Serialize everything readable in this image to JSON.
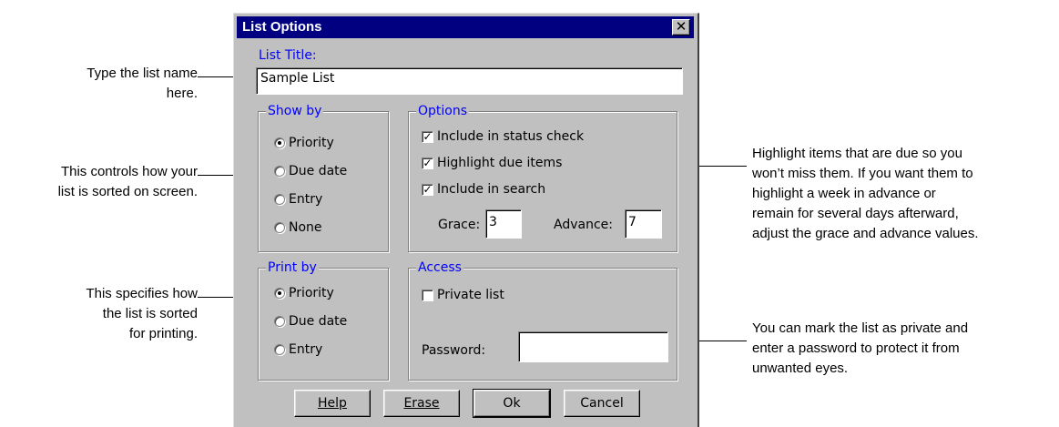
{
  "dialog": {
    "title": "List Options",
    "close_glyph": "✕"
  },
  "list_title": {
    "label": "List Title:",
    "value": "Sample List"
  },
  "show_by": {
    "label": "Show by",
    "options": [
      "Priority",
      "Due date",
      "Entry",
      "None"
    ],
    "selected": "Priority"
  },
  "options": {
    "label": "Options",
    "checks": [
      {
        "label": "Include in status check",
        "checked": true
      },
      {
        "label": "Highlight due items",
        "checked": true
      },
      {
        "label": "Include in search",
        "checked": true
      }
    ],
    "grace_label": "Grace:",
    "grace_value": "3",
    "advance_label": "Advance:",
    "advance_value": "7"
  },
  "print_by": {
    "label": "Print by",
    "options": [
      "Priority",
      "Due date",
      "Entry"
    ],
    "selected": "Priority"
  },
  "access": {
    "label": "Access",
    "private_label": "Private list",
    "private_checked": false,
    "password_label": "Password:",
    "password_value": ""
  },
  "buttons": {
    "help": "Help",
    "erase": "Erase",
    "ok": "Ok",
    "cancel": "Cancel"
  },
  "callouts": {
    "list_name": [
      "Type the list name",
      "here."
    ],
    "show_by": [
      "This controls how your",
      "list is sorted on screen."
    ],
    "print_by": [
      "This specifies how",
      "the list is sorted",
      "for printing."
    ],
    "highlight": [
      "Highlight items that are due so you",
      "won’t miss them. If you want them to",
      "highlight a week in advance or",
      "remain for several days afterward,",
      "adjust the grace and advance values."
    ],
    "private": [
      "You can mark the list as private and",
      "enter a password to protect it from",
      "unwanted eyes."
    ]
  }
}
